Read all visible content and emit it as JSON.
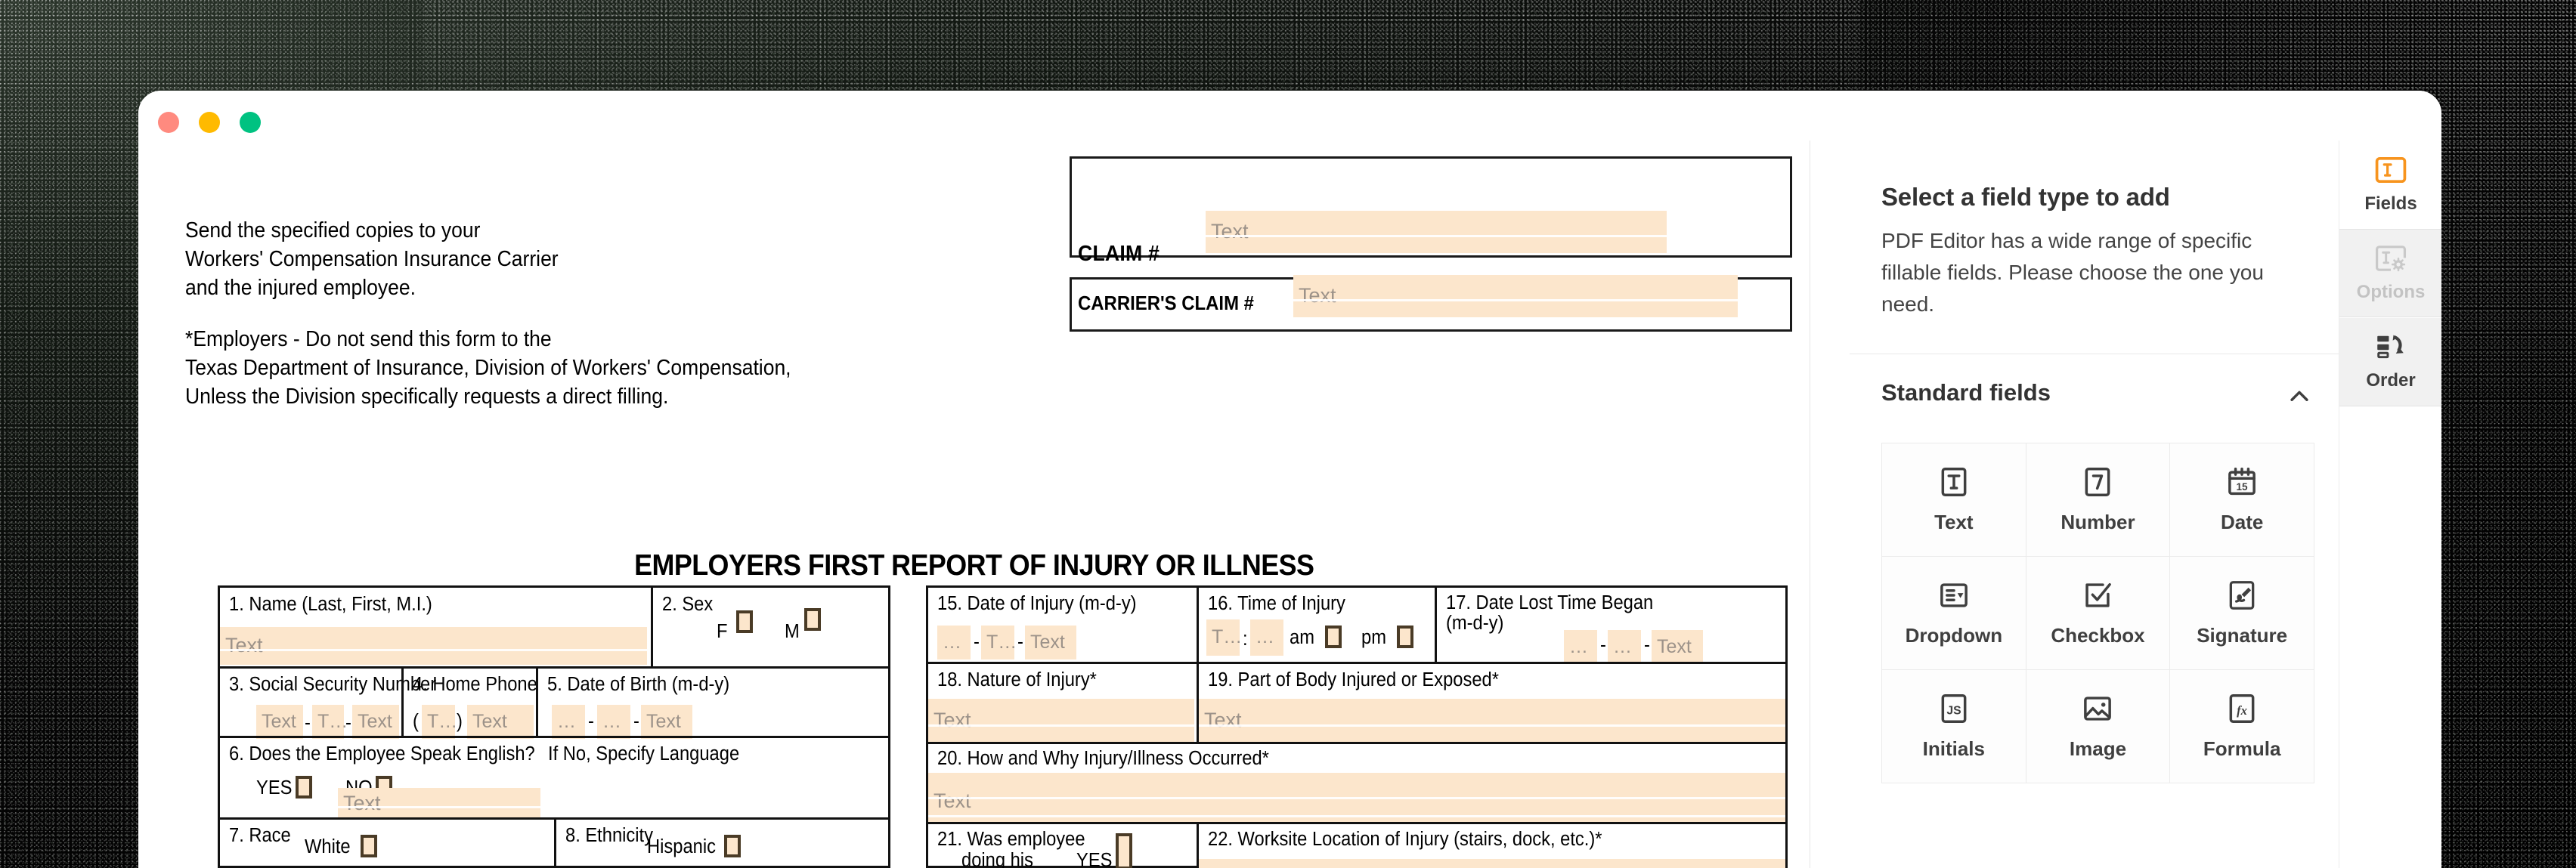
{
  "window": {
    "traffic_lights": [
      {
        "name": "close",
        "color": "#ff8a7f"
      },
      {
        "name": "minimize",
        "color": "#ffba00"
      },
      {
        "name": "maximize",
        "color": "#00c281"
      }
    ]
  },
  "document": {
    "instructions": [
      "Send the specified copies to your",
      "Workers' Compensation Insurance Carrier",
      "and the injured employee.",
      "",
      "*Employers - Do not send this form to the",
      "Texas Department of Insurance, Division of Workers' Compensation,",
      "Unless the Division specifically requests a direct filling."
    ],
    "claim_label": "CLAIM #",
    "carrier_claim_label": "CARRIER'S CLAIM #",
    "field_placeholder": "Text",
    "form_title": "EMPLOYERS FIRST REPORT OF INJURY OR ILLNESS",
    "left_table": {
      "f1_label": "1. Name (Last, First, M.I.)",
      "f1_placeholder": "Text",
      "f2_label": "2. Sex",
      "f2_option_f": "F",
      "f2_option_m": "M",
      "f3_label": "3. Social Security Number",
      "f3_p1": "Text",
      "f3_dash1": "-",
      "f3_p2": "T…",
      "f3_dash2": "-",
      "f3_p3": "Text",
      "f4_label": "4. Home Phone",
      "f4_open": "(",
      "f4_p1": "T…",
      "f4_close": ")",
      "f4_p2": "Text",
      "f5_label": "5. Date of Birth (m-d-y)",
      "f5_p1": "…",
      "f5_dash1": "-",
      "f5_p2": "…",
      "f5_dash2": "-",
      "f5_p3": "Text",
      "f6_label": "6. Does the Employee Speak English?",
      "f6_sublabel": "If No, Specify Language",
      "f6_yes": "YES",
      "f6_no": "NO",
      "f6_placeholder": "Text",
      "f7_label": "7. Race",
      "f7_option": "White",
      "f8_label": "8. Ethnicity",
      "f8_option": "Hispanic"
    },
    "right_table": {
      "f15_label": "15. Date of Injury (m-d-y)",
      "f15_p1": "…",
      "f15_dash1": "-",
      "f15_p2": "T…",
      "f15_dash2": "-",
      "f15_p3": "Text",
      "f16_label": "16. Time of Injury",
      "f16_p1": "T…",
      "f16_colon": ":",
      "f16_p2": "…",
      "f16_am": "am",
      "f16_pm": "pm",
      "f17_label": "17. Date Lost Time Began (m-d-y)",
      "f17_p1": "…",
      "f17_dash1": "-",
      "f17_p2": "…",
      "f17_dash2": "-",
      "f17_p3": "Text",
      "f18_label": "18. Nature of Injury*",
      "f18_placeholder": "Text",
      "f19_label": "19. Part of Body Injured or Exposed*",
      "f19_placeholder": "Text",
      "f20_label": "20. How and Why Injury/Illness Occurred*",
      "f20_placeholder": "Text",
      "f21_label_line1": "21. Was employee",
      "f21_label_line2": "doing his",
      "f21_yes": "YES",
      "f22_label": "22. Worksite Location of Injury (stairs, dock, etc.)*"
    }
  },
  "panel": {
    "title": "Select a field type to add",
    "description": "PDF Editor has a wide range of specific fillable fields. Please choose the one you need.",
    "section": {
      "label": "Standard fields",
      "expanded": true,
      "chevron_icon": "chevron-up-icon"
    },
    "fields": [
      {
        "label": "Text",
        "icon": "text-field-icon"
      },
      {
        "label": "Number",
        "icon": "number-field-icon"
      },
      {
        "label": "Date",
        "icon": "date-field-icon"
      },
      {
        "label": "Dropdown",
        "icon": "dropdown-field-icon"
      },
      {
        "label": "Checkbox",
        "icon": "checkbox-field-icon"
      },
      {
        "label": "Signature",
        "icon": "signature-field-icon"
      },
      {
        "label": "Initials",
        "icon": "initials-field-icon"
      },
      {
        "label": "Image",
        "icon": "image-field-icon"
      },
      {
        "label": "Formula",
        "icon": "formula-field-icon"
      }
    ]
  },
  "rail": {
    "items": [
      {
        "label": "Fields",
        "icon": "fields-icon",
        "state": "active"
      },
      {
        "label": "Options",
        "icon": "options-icon",
        "state": "disabled"
      },
      {
        "label": "Order",
        "icon": "order-icon",
        "state": "default"
      }
    ],
    "accent_color": "#f7941e"
  }
}
